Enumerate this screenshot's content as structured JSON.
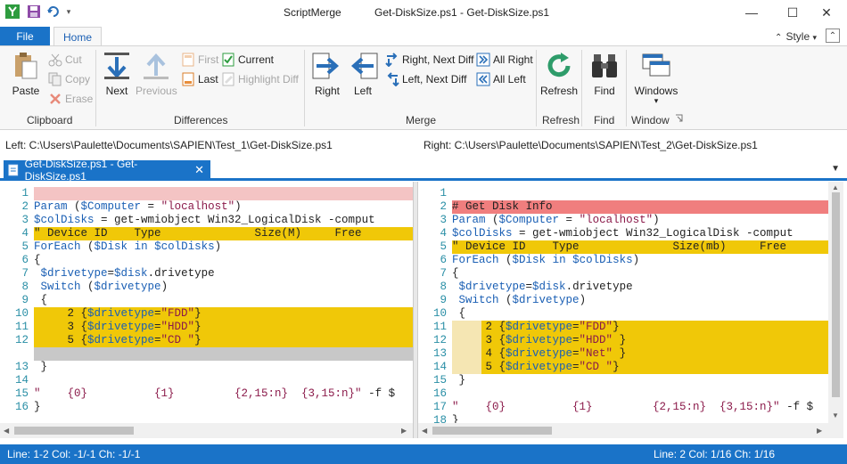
{
  "window": {
    "app_title": "ScriptMerge",
    "doc_title": "Get-DiskSize.ps1 - Get-DiskSize.ps1"
  },
  "ribbon_tabs": {
    "file": "File",
    "home": "Home",
    "style": "Style"
  },
  "clipboard": {
    "paste": "Paste",
    "cut": "Cut",
    "copy": "Copy",
    "erase": "Erase",
    "group": "Clipboard"
  },
  "differences": {
    "next": "Next",
    "previous": "Previous",
    "first": "First",
    "last": "Last",
    "current": "Current",
    "highlight_diff": "Highlight Diff",
    "group": "Differences"
  },
  "merge": {
    "right": "Right",
    "left": "Left",
    "right_next_diff": "Right, Next Diff",
    "left_next_diff": "Left, Next Diff",
    "all_right": "All Right",
    "all_left": "All Left",
    "group": "Merge"
  },
  "refresh": {
    "label": "Refresh",
    "group": "Refresh"
  },
  "find": {
    "label": "Find",
    "group": "Find"
  },
  "window_group": {
    "label": "Windows",
    "group": "Window"
  },
  "paths": {
    "left": "Left: C:\\Users\\Paulette\\Documents\\SAPIEN\\Test_1\\Get-DiskSize.ps1",
    "right": "Right: C:\\Users\\Paulette\\Documents\\SAPIEN\\Test_2\\Get-DiskSize.ps1"
  },
  "doc_tab": {
    "label": "Get-DiskSize.ps1 - Get-DiskSize.ps1"
  },
  "colors": {
    "accent": "#1a73c8",
    "diff_yellow": "#f0c808",
    "diff_light": "#f5e6b3",
    "diff_pink": "#f4c4c4",
    "diff_red": "#f07e7e",
    "diff_gray": "#c8c8c8"
  },
  "left_editor": {
    "lines": [
      {
        "num": "1",
        "text": "",
        "bg": "pink"
      },
      {
        "num": "2",
        "text": "Param ($Computer = \"localhost\")",
        "bg": "none"
      },
      {
        "num": "3",
        "text": "$colDisks = get-wmiobject Win32_LogicalDisk -comput",
        "bg": "none"
      },
      {
        "num": "4",
        "text": "\" Device ID    Type              Size(M)     Free",
        "bg": "yellow"
      },
      {
        "num": "5",
        "text": "ForEach ($Disk in $colDisks)",
        "bg": "none"
      },
      {
        "num": "6",
        "text": "{",
        "bg": "none"
      },
      {
        "num": "7",
        "text": " $drivetype=$disk.drivetype",
        "bg": "none"
      },
      {
        "num": "8",
        "text": " Switch ($drivetype)",
        "bg": "none"
      },
      {
        "num": "9",
        "text": " {",
        "bg": "none"
      },
      {
        "num": "10",
        "text": "     2 {$drivetype=\"FDD\"}",
        "bg": "split"
      },
      {
        "num": "11",
        "text": "     3 {$drivetype=\"HDD\"}",
        "bg": "split"
      },
      {
        "num": "12",
        "text": "     5 {$drivetype=\"CD \"}",
        "bg": "split"
      },
      {
        "num": "",
        "text": "",
        "bg": "gray"
      },
      {
        "num": "13",
        "text": " }",
        "bg": "none"
      },
      {
        "num": "14",
        "text": "",
        "bg": "none"
      },
      {
        "num": "15",
        "text": "\"    {0}          {1}         {2,15:n}  {3,15:n}\" -f $",
        "bg": "none"
      },
      {
        "num": "16",
        "text": "}",
        "bg": "none"
      }
    ]
  },
  "right_editor": {
    "lines": [
      {
        "num": "1",
        "text": "",
        "bg": "none"
      },
      {
        "num": "2",
        "text": "# Get Disk Info",
        "bg": "red"
      },
      {
        "num": "3",
        "text": "Param ($Computer = \"localhost\")",
        "bg": "none"
      },
      {
        "num": "4",
        "text": "$colDisks = get-wmiobject Win32_LogicalDisk -comput",
        "bg": "none"
      },
      {
        "num": "5",
        "text": "\" Device ID    Type              Size(mb)     Free",
        "bg": "yellow"
      },
      {
        "num": "6",
        "text": "ForEach ($Disk in $colDisks)",
        "bg": "none"
      },
      {
        "num": "7",
        "text": "{",
        "bg": "none"
      },
      {
        "num": "8",
        "text": " $drivetype=$disk.drivetype",
        "bg": "none"
      },
      {
        "num": "9",
        "text": " Switch ($drivetype)",
        "bg": "none"
      },
      {
        "num": "10",
        "text": " {",
        "bg": "none"
      },
      {
        "num": "11",
        "text": "     2 {$drivetype=\"FDD\"}",
        "bg": "split"
      },
      {
        "num": "12",
        "text": "     3 {$drivetype=\"HDD\" }",
        "bg": "split"
      },
      {
        "num": "13",
        "text": "     4 {$drivetype=\"Net\" }",
        "bg": "split"
      },
      {
        "num": "14",
        "text": "     5 {$drivetype=\"CD \"}",
        "bg": "split"
      },
      {
        "num": "15",
        "text": " }",
        "bg": "none"
      },
      {
        "num": "16",
        "text": "",
        "bg": "none"
      },
      {
        "num": "17",
        "text": "\"    {0}          {1}         {2,15:n}  {3,15:n}\" -f $",
        "bg": "none"
      },
      {
        "num": "18",
        "text": "}",
        "bg": "none"
      }
    ]
  },
  "status": {
    "left": "Line: 1-2  Col: -1/-1  Ch: -1/-1",
    "right": "Line: 2  Col: 1/16  Ch: 1/16"
  }
}
